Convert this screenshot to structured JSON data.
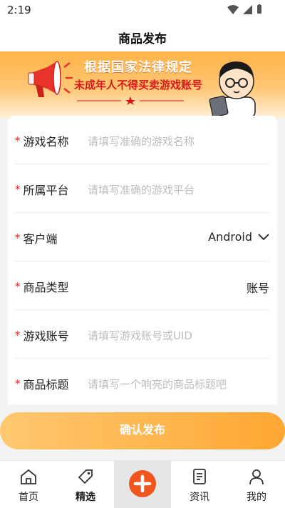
{
  "status_bar": {
    "time": "2:19"
  },
  "header": {
    "title": "商品发布"
  },
  "banner": {
    "line1": "根据国家法律规定",
    "line2": "未成年人不得买卖游戏账号"
  },
  "form": {
    "rows": [
      {
        "label": "游戏名称",
        "placeholder": "请填写准确的游戏名称"
      },
      {
        "label": "所属平台",
        "placeholder": "请填写准确的游戏平台"
      },
      {
        "label": "客户端",
        "value": "Android"
      },
      {
        "label": "商品类型",
        "value": "账号"
      },
      {
        "label": "游戏账号",
        "placeholder": "请填写游戏账号或UID"
      },
      {
        "label": "商品标题",
        "placeholder": "请填写一个响亮的商品标题吧"
      }
    ],
    "required_mark": "*"
  },
  "confirm_button": {
    "label": "确认发布"
  },
  "nav": {
    "items": [
      {
        "label": "首页",
        "icon": "home-icon"
      },
      {
        "label": "精选",
        "icon": "tag-icon"
      },
      {
        "label": "",
        "icon": "plus-icon"
      },
      {
        "label": "资讯",
        "icon": "document-icon"
      },
      {
        "label": "我的",
        "icon": "person-icon"
      }
    ]
  },
  "colors": {
    "accent": "#ffa733",
    "required": "#e02020",
    "publish": "#f0551e"
  }
}
